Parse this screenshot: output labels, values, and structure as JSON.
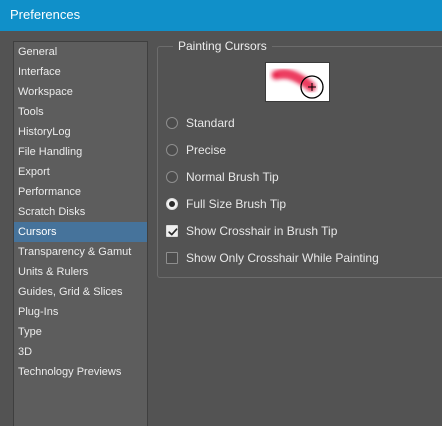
{
  "window": {
    "title": "Preferences"
  },
  "sidebar": {
    "items": [
      {
        "label": "General"
      },
      {
        "label": "Interface"
      },
      {
        "label": "Workspace"
      },
      {
        "label": "Tools"
      },
      {
        "label": "HistoryLog"
      },
      {
        "label": "File Handling"
      },
      {
        "label": "Export"
      },
      {
        "label": "Performance"
      },
      {
        "label": "Scratch Disks"
      },
      {
        "label": "Cursors"
      },
      {
        "label": "Transparency & Gamut"
      },
      {
        "label": "Units & Rulers"
      },
      {
        "label": "Guides, Grid & Slices"
      },
      {
        "label": "Plug-Ins"
      },
      {
        "label": "Type"
      },
      {
        "label": "3D"
      },
      {
        "label": "Technology Previews"
      }
    ],
    "selected": "Cursors"
  },
  "painting_cursors": {
    "legend": "Painting Cursors",
    "preview_icon": "brush-cursor-preview",
    "options": [
      {
        "label": "Standard",
        "type": "radio",
        "checked": false
      },
      {
        "label": "Precise",
        "type": "radio",
        "checked": false
      },
      {
        "label": "Normal Brush Tip",
        "type": "radio",
        "checked": false
      },
      {
        "label": "Full Size Brush Tip",
        "type": "radio",
        "checked": true
      },
      {
        "label": "Show Crosshair in Brush Tip",
        "type": "checkbox",
        "checked": true
      },
      {
        "label": "Show Only Crosshair While Painting",
        "type": "checkbox",
        "checked": false
      }
    ]
  },
  "colors": {
    "titlebar": "#1090c9",
    "selection": "#46739b",
    "stroke": "#e8133f"
  }
}
